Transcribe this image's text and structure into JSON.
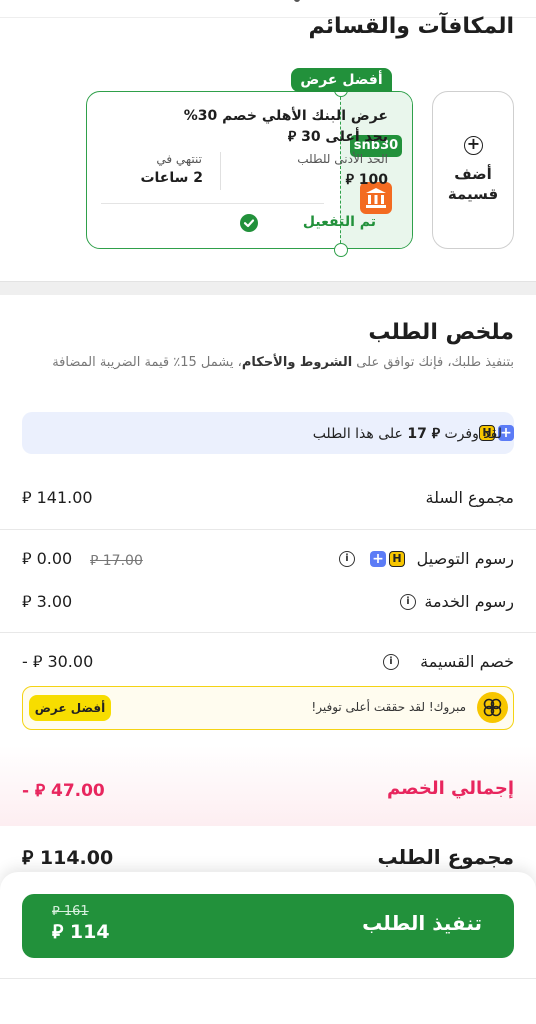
{
  "rewards": {
    "title": "المكافآت والقسائم",
    "add_voucher_label": "أضف\nقسيمة",
    "offer": {
      "best_tag": "أفضل عرض",
      "code": "snb30",
      "title": "عرض البنك الأهلي خصم 30% بحد أعلى 30 ⃁",
      "min_order_label": "الحد الأدنى للطلب",
      "min_order_value": "100 ⃁",
      "expires_label": "تنتهي في",
      "expires_value": "2 ساعات",
      "activated_label": "تم التفعيل"
    }
  },
  "summary": {
    "title": "ملخص الطلب",
    "terms_prefix": "بتنفيذ طلبك، فإنك توافق على ",
    "terms_link": "الشروط والأحكام",
    "terms_suffix": "، يشمل 15٪ قيمة الضريبة المضافة",
    "savings_prefix": "لقد وفرت ",
    "savings_amount": "⃁ 17",
    "savings_suffix": " على هذا الطلب",
    "basket_total_label": "مجموع السلة",
    "basket_total_value": "⃁ 141.00",
    "delivery_fee_label": "رسوم التوصيل",
    "delivery_fee_value": "⃁ 0.00",
    "delivery_fee_old": "⃁ 17.00",
    "service_fee_label": "رسوم الخدمة",
    "service_fee_value": "⃁ 3.00",
    "voucher_discount_label": "خصم القسيمة",
    "voucher_discount_value": "- ⃁ 30.00",
    "congrats_text": "مبروك! لقد حققت أعلى توفير!",
    "congrats_badge": "أفضل عرض",
    "total_discount_label": "إجمالي الخصم",
    "total_discount_value": "- ⃁ 47.00",
    "order_total_label": "مجموع الطلب",
    "order_total_value": "⃁ 114.00"
  },
  "checkout": {
    "button_label": "تنفيذ الطلب",
    "old_price": "⃁ 161",
    "new_price": "⃁ 114"
  },
  "badges": {
    "plus": "+",
    "h": "H",
    "info": "i"
  },
  "colors": {
    "brand_green": "#22913b",
    "discount_pink": "#e8265e",
    "accent_orange": "#f36b21",
    "highlight_yellow": "#f7c600",
    "savings_blue": "#ebf0fd"
  }
}
